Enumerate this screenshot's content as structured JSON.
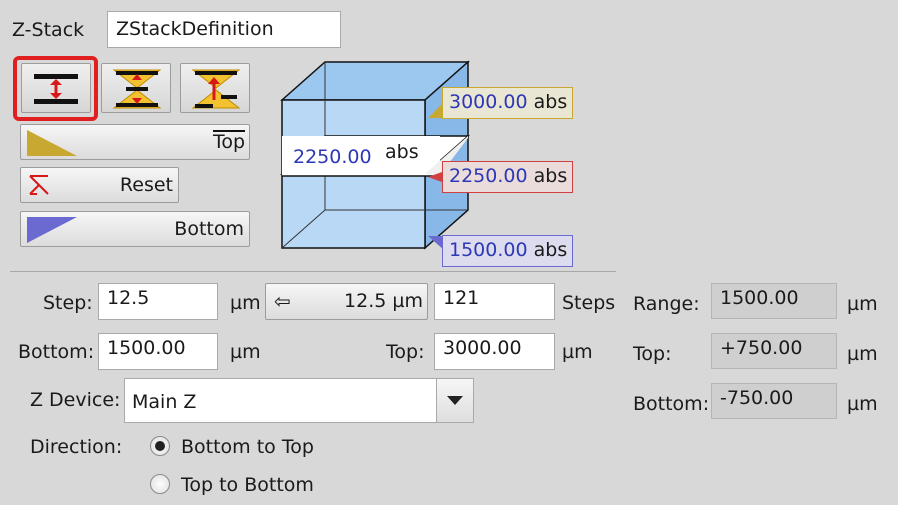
{
  "header": {
    "label": "Z-Stack",
    "definition_value": "ZStackDefinition"
  },
  "mode_buttons": [
    {
      "icon": "first-last-mode-icon",
      "selected": true
    },
    {
      "icon": "center-mode-icon",
      "selected": false
    },
    {
      "icon": "center-offset-mode-icon",
      "selected": false
    }
  ],
  "buttons": {
    "top_label": "Top",
    "reset_label": "Reset",
    "bottom_label": "Bottom"
  },
  "visual": {
    "top_value": "3000.00",
    "top_unit": "abs",
    "center_value": "2250.00",
    "center_unit": "abs",
    "slice_value": "2250.00",
    "slice_unit": "abs",
    "bottom_value": "1500.00",
    "bottom_unit": "abs"
  },
  "step": {
    "label": "Step:",
    "value": "12.5",
    "unit": "µm",
    "optimal_value": "12.5 µm",
    "count_value": "121",
    "count_label": "Steps"
  },
  "range_limits": {
    "bottom_label": "Bottom:",
    "bottom_value": "1500.00",
    "bottom_unit": "µm",
    "top_label": "Top:",
    "top_value": "3000.00",
    "top_unit": "µm"
  },
  "device": {
    "label": "Z Device:",
    "selected": "Main Z"
  },
  "direction": {
    "label": "Direction:",
    "options": [
      "Bottom to Top",
      "Top to Bottom"
    ],
    "selected": "Bottom to Top"
  },
  "summary": {
    "range_label": "Range:",
    "range_value": "1500.00",
    "range_unit": "µm",
    "top_label": "Top:",
    "top_value": "+750.00",
    "top_unit": "µm",
    "bottom_label": "Bottom:",
    "bottom_value": "-750.00",
    "bottom_unit": "µm"
  },
  "colors": {
    "highlight": "#e02020",
    "top_marker": "#c8a830",
    "center_marker": "#d04040",
    "bottom_marker": "#6a6ad0",
    "value_text": "#2d38b5"
  }
}
